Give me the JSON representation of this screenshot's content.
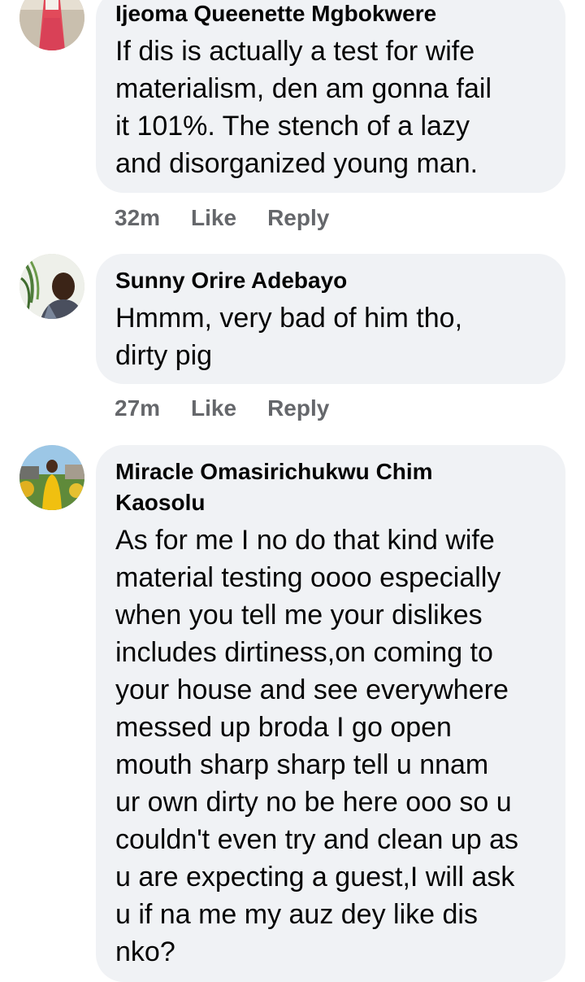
{
  "comments": [
    {
      "author": "Ijeoma Queenette Mgbokwere",
      "text_lines": [
        "If dis is actually a test for wife",
        "materialism, den am gonna fail",
        "it 101%. The stench of a lazy",
        "and disorganized young man."
      ],
      "time": "32m",
      "like_label": "Like",
      "reply_label": "Reply"
    },
    {
      "author": "Sunny Orire Adebayo",
      "text_lines": [
        "Hmmm, very bad of him tho,",
        "dirty pig"
      ],
      "time": "27m",
      "like_label": "Like",
      "reply_label": "Reply"
    },
    {
      "author_lines": [
        "Miracle Omasirichukwu Chim",
        "Kaosolu"
      ],
      "text_lines": [
        "As for me I no do that kind wife",
        "material testing oooo especially",
        "when you tell me your dislikes",
        "includes dirtiness,on coming to",
        "your house and see everywhere",
        "messed up broda I go open",
        "mouth sharp sharp tell u nnam",
        "ur own dirty no be here ooo so u",
        "couldn't even try and clean up as",
        "u are expecting a guest,I will ask",
        "u if na me my auz dey like dis",
        "nko?"
      ]
    }
  ],
  "colors": {
    "bubble": "#f0f2f5",
    "meta_text": "#65676b",
    "text": "#050505"
  }
}
